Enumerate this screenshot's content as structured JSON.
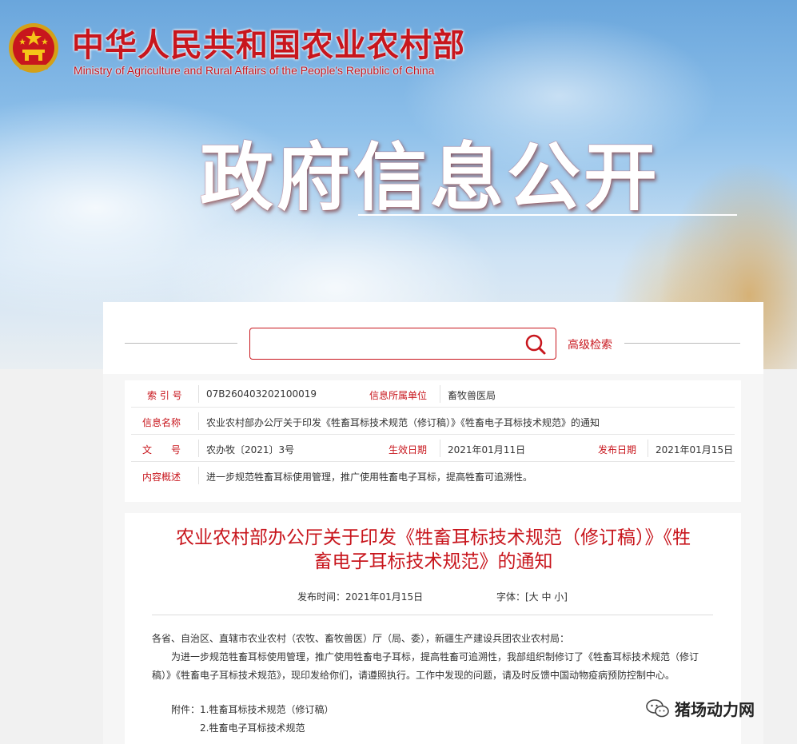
{
  "header": {
    "ministry_cn": "中华人民共和国农业农村部",
    "ministry_en": "Ministry of Agriculture and Rural Affairs of the People's Republic of China",
    "section_title": "政府信息公开"
  },
  "search": {
    "placeholder": "",
    "advanced_label": "高级检索"
  },
  "meta": {
    "index_label": "索 引 号",
    "index_value": "07B260403202100019",
    "unit_label": "信息所属单位",
    "unit_value": "畜牧兽医局",
    "name_label": "信息名称",
    "name_value": "农业农村部办公厅关于印发《牲畜耳标技术规范（修订稿）》《牲畜电子耳标技术规范》的通知",
    "doc_label": "文　　号",
    "doc_value": "农办牧〔2021〕3号",
    "effective_label": "生效日期",
    "effective_value": "2021年01月11日",
    "publish_label": "发布日期",
    "publish_value": "2021年01月15日",
    "summary_label": "内容概述",
    "summary_value": "进一步规范牲畜耳标使用管理，推广使用牲畜电子耳标，提高牲畜可追溯性。"
  },
  "article": {
    "title_line1": "农业农村部办公厅关于印发《牲畜耳标技术规范（修订稿）》《牲",
    "title_line2": "畜电子耳标技术规范》的通知",
    "publish_time": "发布时间：2021年01月15日",
    "font_size_label": "字体：[大 中 小]",
    "salutation": "各省、自治区、直辖市农业农村（农牧、畜牧兽医）厅（局、委），新疆生产建设兵团农业农村局：",
    "para1_line1": "为进一步规范牲畜耳标使用管理，推广使用牲畜电子耳标，提高牲畜可追溯性，我部组织制修订了《牲畜耳标技术规范（修订",
    "para1_line2": "稿）》《牲畜电子耳标技术规范》，现印发给你们，请遵照执行。工作中发现的问题，请及时反馈中国动物疫病预防控制中心。",
    "attachment1": "附件：1.牲畜耳标技术规范（修订稿）",
    "attachment2": "2.牲畜电子耳标技术规范"
  },
  "watermark": {
    "text": "猪场动力网"
  },
  "colors": {
    "accent_red": "#c8161d"
  }
}
